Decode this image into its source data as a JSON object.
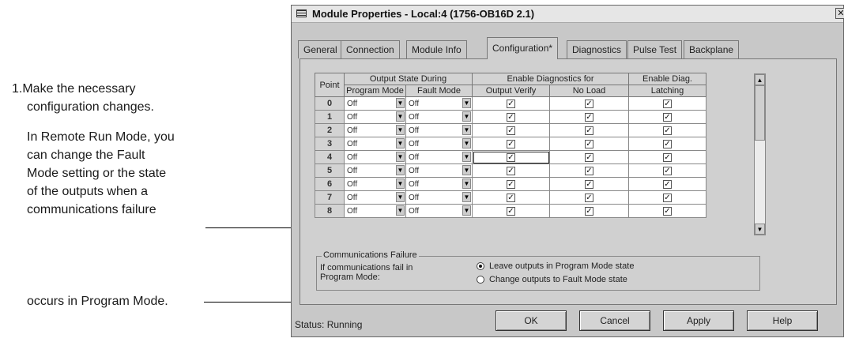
{
  "annotations": {
    "step1_line1": "1.Make the necessary",
    "step1_line2": "configuration changes.",
    "remote_run": [
      "In Remote Run Mode, you",
      "can change the Fault",
      "Mode setting or the state",
      "of the outputs when a",
      "communications failure"
    ],
    "program_mode": "occurs in Program Mode."
  },
  "window": {
    "title": "Module Properties - Local:4 (1756-OB16D 2.1)",
    "close_glyph": "✕"
  },
  "tabs": [
    {
      "label": "General"
    },
    {
      "label": "Connection"
    },
    {
      "label": "Module Info"
    },
    {
      "label": "Configuration*"
    },
    {
      "label": "Diagnostics"
    },
    {
      "label": "Pulse Test"
    },
    {
      "label": "Backplane"
    }
  ],
  "active_tab": "Configuration*",
  "table": {
    "headers": {
      "point": "Point",
      "output_state_during": "Output State During",
      "enable_diagnostics_for": "Enable Diagnostics for",
      "enable_diag_latching_1": "Enable Diag.",
      "enable_diag_latching_2": "Latching",
      "program_mode": "Program Mode",
      "fault_mode": "Fault Mode",
      "output_verify": "Output Verify",
      "no_load": "No Load"
    },
    "rows": [
      {
        "point": "0",
        "program_mode": "Off",
        "fault_mode": "Off",
        "output_verify": true,
        "no_load": true,
        "latching": true
      },
      {
        "point": "1",
        "program_mode": "Off",
        "fault_mode": "Off",
        "output_verify": true,
        "no_load": true,
        "latching": true
      },
      {
        "point": "2",
        "program_mode": "Off",
        "fault_mode": "Off",
        "output_verify": true,
        "no_load": true,
        "latching": true
      },
      {
        "point": "3",
        "program_mode": "Off",
        "fault_mode": "Off",
        "output_verify": true,
        "no_load": true,
        "latching": true
      },
      {
        "point": "4",
        "program_mode": "Off",
        "fault_mode": "Off",
        "output_verify": true,
        "no_load": true,
        "latching": true
      },
      {
        "point": "5",
        "program_mode": "Off",
        "fault_mode": "Off",
        "output_verify": true,
        "no_load": true,
        "latching": true
      },
      {
        "point": "6",
        "program_mode": "Off",
        "fault_mode": "Off",
        "output_verify": true,
        "no_load": true,
        "latching": true
      },
      {
        "point": "7",
        "program_mode": "Off",
        "fault_mode": "Off",
        "output_verify": true,
        "no_load": true,
        "latching": true
      },
      {
        "point": "8",
        "program_mode": "Off",
        "fault_mode": "Off",
        "output_verify": true,
        "no_load": true,
        "latching": true
      }
    ]
  },
  "glyphs": {
    "dropdown": "▼",
    "check": "✓",
    "scroll_up": "▲",
    "scroll_down": "▼"
  },
  "comm_failure": {
    "legend": "Communications Failure",
    "prompt_line1": "If communications fail in",
    "prompt_line2": "Program Mode:",
    "options": [
      {
        "label": "Leave outputs in Program Mode state",
        "selected": true
      },
      {
        "label": "Change outputs to Fault Mode state",
        "selected": false
      }
    ]
  },
  "status": "Status:  Running",
  "buttons": {
    "ok": "OK",
    "cancel": "Cancel",
    "apply": "Apply",
    "help": "Help"
  }
}
